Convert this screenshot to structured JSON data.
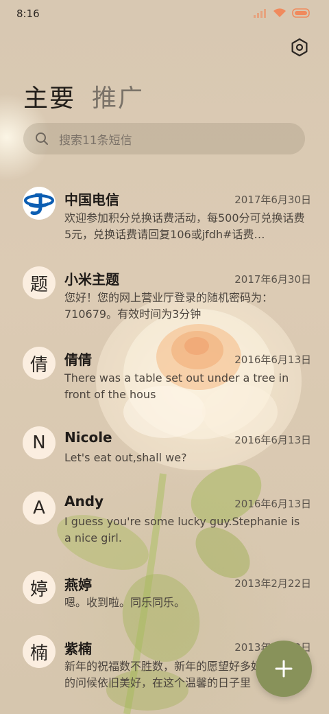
{
  "status_bar": {
    "time": "8:16",
    "icons": [
      "signal-icon",
      "wifi-icon",
      "battery-icon"
    ],
    "accent_color": "#f08a5d"
  },
  "header": {
    "settings_icon": "settings-hexagon-icon"
  },
  "tabs": [
    {
      "label": "主要",
      "active": true
    },
    {
      "label": "推广",
      "active": false
    }
  ],
  "search": {
    "placeholder": "搜索11条短信",
    "icon": "search-icon"
  },
  "conversations": [
    {
      "avatar": "",
      "avatar_icon": "china-telecom-logo",
      "name": "中国电信",
      "date": "2017年6月30日",
      "preview": "欢迎参加积分兑换话费活动，每500分可兑换话费5元，兑换话费请回复106或jfdh#话费…"
    },
    {
      "avatar": "题",
      "name": "小米主题",
      "date": "2017年6月30日",
      "preview": "您好！您的网上营业厅登录的随机密码为：710679。有效时间为3分钟"
    },
    {
      "avatar": "倩",
      "name": "倩倩",
      "date": "2016年6月13日",
      "preview": "There was a table set out under a tree in front of the hous"
    },
    {
      "avatar": "N",
      "name": "Nicole",
      "date": "2016年6月13日",
      "preview": "Let's eat out,shall we?"
    },
    {
      "avatar": "A",
      "name": "Andy",
      "date": "2016年6月13日",
      "preview": "I guess you're some lucky guy.Stephanie is a nice girl."
    },
    {
      "avatar": "婷",
      "name": "燕婷",
      "date": "2013年2月22日",
      "preview": "嗯。收到啦。同乐同乐。"
    },
    {
      "avatar": "楠",
      "name": "紫楠",
      "date": "2013年2月22日",
      "preview": "新年的祝福数不胜数，新年的愿望好多好多，新年的问候依旧美好，在这个温馨的日子里"
    }
  ],
  "fab": {
    "icon": "plus-icon",
    "color": "#88925a"
  }
}
